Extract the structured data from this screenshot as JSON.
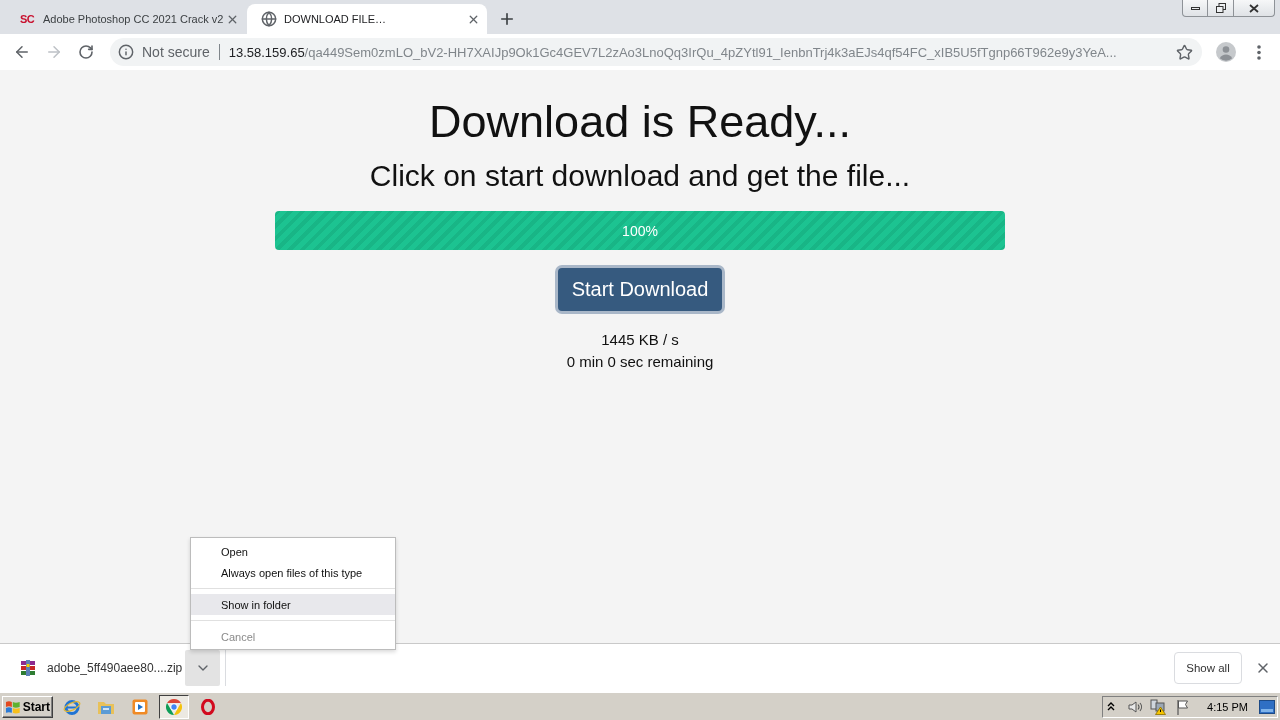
{
  "tabs": [
    {
      "favicon": {
        "kind": "text",
        "text": "SC"
      },
      "title": "Adobe Photoshop CC 2021 Crack v2",
      "selected": false
    },
    {
      "favicon": {
        "kind": "globe"
      },
      "title": "DOWNLOAD FILE…",
      "selected": true
    }
  ],
  "toolbar": {
    "nav_buttons": [
      {
        "kind": "back",
        "disabled": false
      },
      {
        "kind": "forward",
        "disabled": true
      },
      {
        "kind": "reload",
        "disabled": false
      }
    ],
    "security_label": "Not secure",
    "url_host": "13.58.159.65",
    "url_path": "/qa449Sem0zmLO_bV2-HH7XAIJp9Ok1Gc4GEV7L2zAo3LnoQq3IrQu_4pZYtl91_IenbnTrj4k3aEJs4qf54FC_xIB5U5fTgnp66T962e9y3YeA..."
  },
  "page": {
    "heading": "Download is Ready...",
    "subheading": "Click on start download and get the file...",
    "progress": {
      "level": 1,
      "label": "100%"
    },
    "button_label": "Start Download",
    "speed": "1445 KB / s",
    "remaining": "0 min 0 sec remaining"
  },
  "context_menu": {
    "items": [
      {
        "kind": "item",
        "label": "Open",
        "highlighted": false,
        "disabled": false
      },
      {
        "kind": "item",
        "label": "Always open files of this type",
        "highlighted": false,
        "disabled": false
      },
      {
        "kind": "separator"
      },
      {
        "kind": "item",
        "label": "Show in folder",
        "highlighted": true,
        "disabled": false
      },
      {
        "kind": "separator"
      },
      {
        "kind": "item",
        "label": "Cancel",
        "highlighted": false,
        "disabled": true
      }
    ]
  },
  "download_shelf": {
    "file_name": "adobe_5ff490aee80....zip",
    "menu_open": true,
    "show_all_label": "Show all"
  },
  "taskbar": {
    "start_label": "Start",
    "apps": [
      {
        "kind": "ie",
        "active": false
      },
      {
        "kind": "explorer",
        "active": false
      },
      {
        "kind": "media",
        "active": false
      },
      {
        "kind": "chrome",
        "active": true
      },
      {
        "kind": "opera",
        "active": false
      }
    ],
    "clock": "4:15 PM"
  }
}
